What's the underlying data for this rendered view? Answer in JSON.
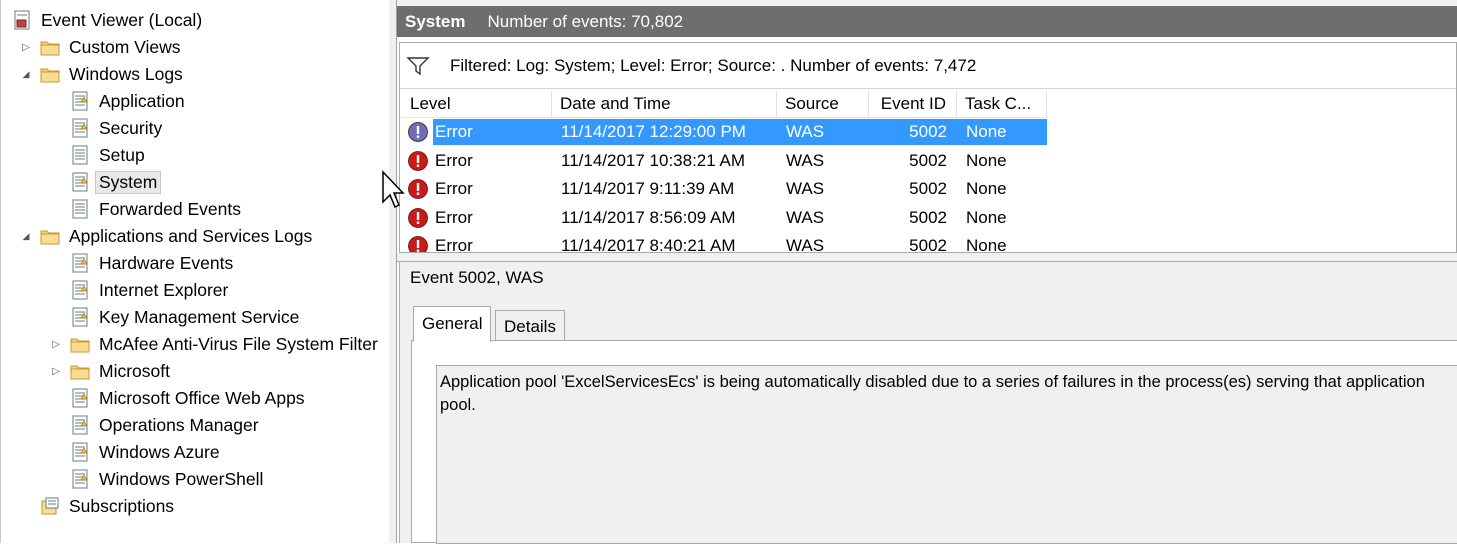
{
  "tree": {
    "items": [
      {
        "label": "Event Viewer (Local)",
        "level": 0,
        "expander": "",
        "icon": "event-viewer-icon"
      },
      {
        "label": "Custom Views",
        "level": 1,
        "expander": "collapsed",
        "icon": "folder-icon"
      },
      {
        "label": "Windows Logs",
        "level": 1,
        "expander": "expanded",
        "icon": "folder-icon"
      },
      {
        "label": "Application",
        "level": 2,
        "expander": "",
        "icon": "log-icon"
      },
      {
        "label": "Security",
        "level": 2,
        "expander": "",
        "icon": "log-icon"
      },
      {
        "label": "Setup",
        "level": 2,
        "expander": "",
        "icon": "log-plain-icon"
      },
      {
        "label": "System",
        "level": 2,
        "expander": "",
        "icon": "log-icon",
        "selected": true
      },
      {
        "label": "Forwarded Events",
        "level": 2,
        "expander": "",
        "icon": "log-plain-icon"
      },
      {
        "label": "Applications and Services Logs",
        "level": 1,
        "expander": "expanded",
        "icon": "folder-icon"
      },
      {
        "label": "Hardware Events",
        "level": 2,
        "expander": "",
        "icon": "log-icon"
      },
      {
        "label": "Internet Explorer",
        "level": 2,
        "expander": "",
        "icon": "log-icon"
      },
      {
        "label": "Key Management Service",
        "level": 2,
        "expander": "",
        "icon": "log-icon"
      },
      {
        "label": "McAfee Anti-Virus File System Filter",
        "level": 2,
        "expander": "collapsed",
        "icon": "folder-icon"
      },
      {
        "label": "Microsoft",
        "level": 2,
        "expander": "collapsed",
        "icon": "folder-icon"
      },
      {
        "label": "Microsoft Office Web Apps",
        "level": 2,
        "expander": "",
        "icon": "log-icon"
      },
      {
        "label": "Operations Manager",
        "level": 2,
        "expander": "",
        "icon": "log-icon"
      },
      {
        "label": "Windows Azure",
        "level": 2,
        "expander": "",
        "icon": "log-icon"
      },
      {
        "label": "Windows PowerShell",
        "level": 2,
        "expander": "",
        "icon": "log-icon"
      },
      {
        "label": "Subscriptions",
        "level": 1,
        "expander": "",
        "icon": "subscriptions-icon"
      }
    ]
  },
  "header": {
    "title": "System",
    "count_text": "Number of events: 70,802"
  },
  "filter": {
    "text": "Filtered: Log: System; Level: Error; Source: . Number of events: 7,472"
  },
  "columns": [
    "Level",
    "Date and Time",
    "Source",
    "Event ID",
    "Task C..."
  ],
  "events": [
    {
      "level": "Error",
      "datetime": "11/14/2017 12:29:00 PM",
      "source": "WAS",
      "event_id": "5002",
      "task": "None",
      "selected": true
    },
    {
      "level": "Error",
      "datetime": "11/14/2017 10:38:21 AM",
      "source": "WAS",
      "event_id": "5002",
      "task": "None"
    },
    {
      "level": "Error",
      "datetime": "11/14/2017 9:11:39 AM",
      "source": "WAS",
      "event_id": "5002",
      "task": "None"
    },
    {
      "level": "Error",
      "datetime": "11/14/2017 8:56:09 AM",
      "source": "WAS",
      "event_id": "5002",
      "task": "None"
    },
    {
      "level": "Error",
      "datetime": "11/14/2017 8:40:21 AM",
      "source": "WAS",
      "event_id": "5002",
      "task": "None"
    }
  ],
  "detail": {
    "title": "Event 5002, WAS",
    "tabs": [
      "General",
      "Details"
    ],
    "message": "Application pool 'ExcelServicesEcs' is being automatically disabled due to a series of failures in the process(es) serving that application pool."
  },
  "colors": {
    "header_bg": "#6e6e6e",
    "selection": "#3399ff",
    "error_red": "#cc1a1a"
  }
}
